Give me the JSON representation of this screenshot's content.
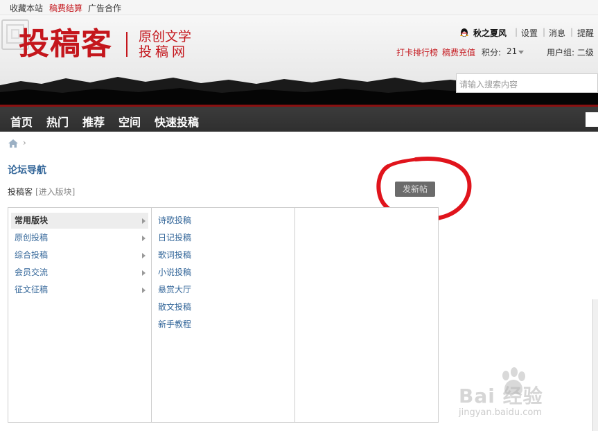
{
  "topbar": {
    "links": [
      {
        "label": "收藏本站",
        "highlight": false
      },
      {
        "label": "稿费结算",
        "highlight": true
      },
      {
        "label": "广告合作",
        "highlight": false
      }
    ]
  },
  "header": {
    "logo": "投稿客",
    "slogan_line1": "原创文学",
    "slogan_line2": "投稿网",
    "brand_color": "#c4161c"
  },
  "user": {
    "name": "秋之夏风",
    "settings": "设置",
    "messages": "消息",
    "reminders": "提醒",
    "checkin_rank": "打卡排行榜",
    "recharge": "稿费充值",
    "credits_label": "积分:",
    "credits_value": "21",
    "group_label": "用户组: 二级"
  },
  "search": {
    "placeholder": "请输入搜索内容"
  },
  "nav": {
    "items": [
      "首页",
      "热门",
      "推荐",
      "空间",
      "快速投稿"
    ]
  },
  "page": {
    "title": "论坛导航",
    "forum_name": "投稿客",
    "enter_link": "[进入版块]",
    "post_button": "发新帖"
  },
  "categories": [
    {
      "label": "常用版块",
      "active": true
    },
    {
      "label": "原创投稿",
      "active": false
    },
    {
      "label": "综合投稿",
      "active": false
    },
    {
      "label": "会员交流",
      "active": false
    },
    {
      "label": "征文征稿",
      "active": false
    }
  ],
  "subforums": [
    "诗歌投稿",
    "日记投稿",
    "歌词投稿",
    "小说投稿",
    "悬赏大厅",
    "散文投稿",
    "新手教程"
  ],
  "watermark": {
    "main": "Bai 经验",
    "url": "jingyan.baidu.com"
  },
  "colors": {
    "link": "#336699",
    "nav_bg": "#333333",
    "annotation": "#e0141c"
  }
}
